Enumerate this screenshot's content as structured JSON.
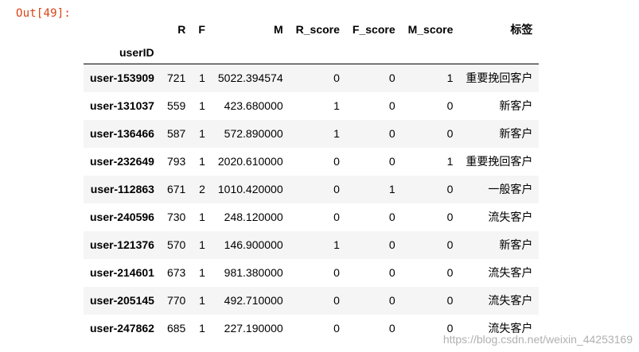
{
  "output_prompt": "Out[49]:",
  "table": {
    "index_name": "userID",
    "columns": [
      "R",
      "F",
      "M",
      "R_score",
      "F_score",
      "M_score",
      "标签"
    ],
    "rows": [
      {
        "index": "user-153909",
        "cells": [
          "721",
          "1",
          "5022.394574",
          "0",
          "0",
          "1",
          "重要挽回客户"
        ]
      },
      {
        "index": "user-131037",
        "cells": [
          "559",
          "1",
          "423.680000",
          "1",
          "0",
          "0",
          "新客户"
        ]
      },
      {
        "index": "user-136466",
        "cells": [
          "587",
          "1",
          "572.890000",
          "1",
          "0",
          "0",
          "新客户"
        ]
      },
      {
        "index": "user-232649",
        "cells": [
          "793",
          "1",
          "2020.610000",
          "0",
          "0",
          "1",
          "重要挽回客户"
        ]
      },
      {
        "index": "user-112863",
        "cells": [
          "671",
          "2",
          "1010.420000",
          "0",
          "1",
          "0",
          "一般客户"
        ]
      },
      {
        "index": "user-240596",
        "cells": [
          "730",
          "1",
          "248.120000",
          "0",
          "0",
          "0",
          "流失客户"
        ]
      },
      {
        "index": "user-121376",
        "cells": [
          "570",
          "1",
          "146.900000",
          "1",
          "0",
          "0",
          "新客户"
        ]
      },
      {
        "index": "user-214601",
        "cells": [
          "673",
          "1",
          "981.380000",
          "0",
          "0",
          "0",
          "流失客户"
        ]
      },
      {
        "index": "user-205145",
        "cells": [
          "770",
          "1",
          "492.710000",
          "0",
          "0",
          "0",
          "流失客户"
        ]
      },
      {
        "index": "user-247862",
        "cells": [
          "685",
          "1",
          "227.190000",
          "0",
          "0",
          "0",
          "流失客户"
        ]
      }
    ]
  },
  "watermark": "https://blog.csdn.net/weixin_44253169"
}
